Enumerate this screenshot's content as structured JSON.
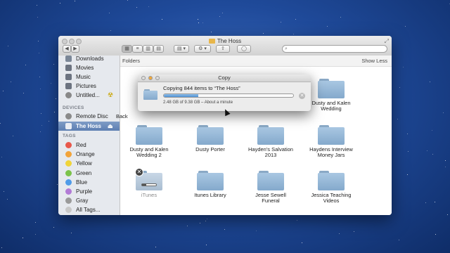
{
  "window": {
    "title": "The Hoss",
    "toolbar": {
      "back_label": "◀",
      "forward_label": "▶",
      "view_icons": [
        "icon-view-icon",
        "list-view-icon",
        "column-view-icon",
        "coverflow-view-icon"
      ],
      "arrange_label": "▤ ▾",
      "action_label": "⚙ ▾",
      "share_label": "⇧",
      "tag_label": "◯",
      "search_placeholder": "",
      "search_icon": "🔍"
    },
    "fullscreen_icon": "⤢"
  },
  "sidebar": {
    "favorites": [
      {
        "label": "Downloads",
        "icon": "downloads-icon",
        "color": "#7b8797"
      },
      {
        "label": "Movies",
        "icon": "movies-icon",
        "color": "#6c7380"
      },
      {
        "label": "Music",
        "icon": "music-icon",
        "color": "#6c7380"
      },
      {
        "label": "Pictures",
        "icon": "pictures-icon",
        "color": "#6c7380"
      },
      {
        "label": "Untitled...",
        "icon": "disc-icon",
        "color": "#888"
      }
    ],
    "untitled_badge": "☢",
    "devices_header": "DEVICES",
    "devices": [
      {
        "label": "Remote Disc",
        "icon": "remote-disc-icon"
      },
      {
        "label": "The Hoss",
        "icon": "drive-icon",
        "selected": true,
        "eject": "⏏"
      }
    ],
    "tags_header": "TAGS",
    "tags": [
      {
        "label": "Red",
        "color": "#e8584b"
      },
      {
        "label": "Orange",
        "color": "#f2a33a"
      },
      {
        "label": "Yellow",
        "color": "#f0d43a"
      },
      {
        "label": "Green",
        "color": "#7bc34a"
      },
      {
        "label": "Blue",
        "color": "#4f9be8"
      },
      {
        "label": "Purple",
        "color": "#b27bd6"
      },
      {
        "label": "Gray",
        "color": "#9a9a9a"
      },
      {
        "label": "All Tags...",
        "color": "#c8c8c8"
      }
    ]
  },
  "content": {
    "section_label": "Folders",
    "toggle_label": "Show Less",
    "folders_row1": [
      {
        "name": "Back"
      },
      {
        "name": "Dusty and Kalen\nWedding"
      }
    ],
    "folders_row2": [
      {
        "name": "Dusty and Kalen\nWedding 2"
      },
      {
        "name": "Dusty Porter"
      },
      {
        "name": "Hayden's Salvation\n2013"
      },
      {
        "name": "Haydens Interview\nMoney Jars"
      }
    ],
    "folders_row3": [
      {
        "name": "iTunes",
        "copying": true,
        "progress": 0.3
      },
      {
        "name": "Itunes Library"
      },
      {
        "name": "Jesse Sewell\nFuneral"
      },
      {
        "name": "Jessica Teaching\nVideos"
      }
    ]
  },
  "copy_dialog": {
    "title": "Copy",
    "message": "Copying 844 items to “The Hoss”",
    "progress": 0.265,
    "status": "2.48 GB of 9.38 GB – About a minute",
    "stop_label": "✕"
  }
}
